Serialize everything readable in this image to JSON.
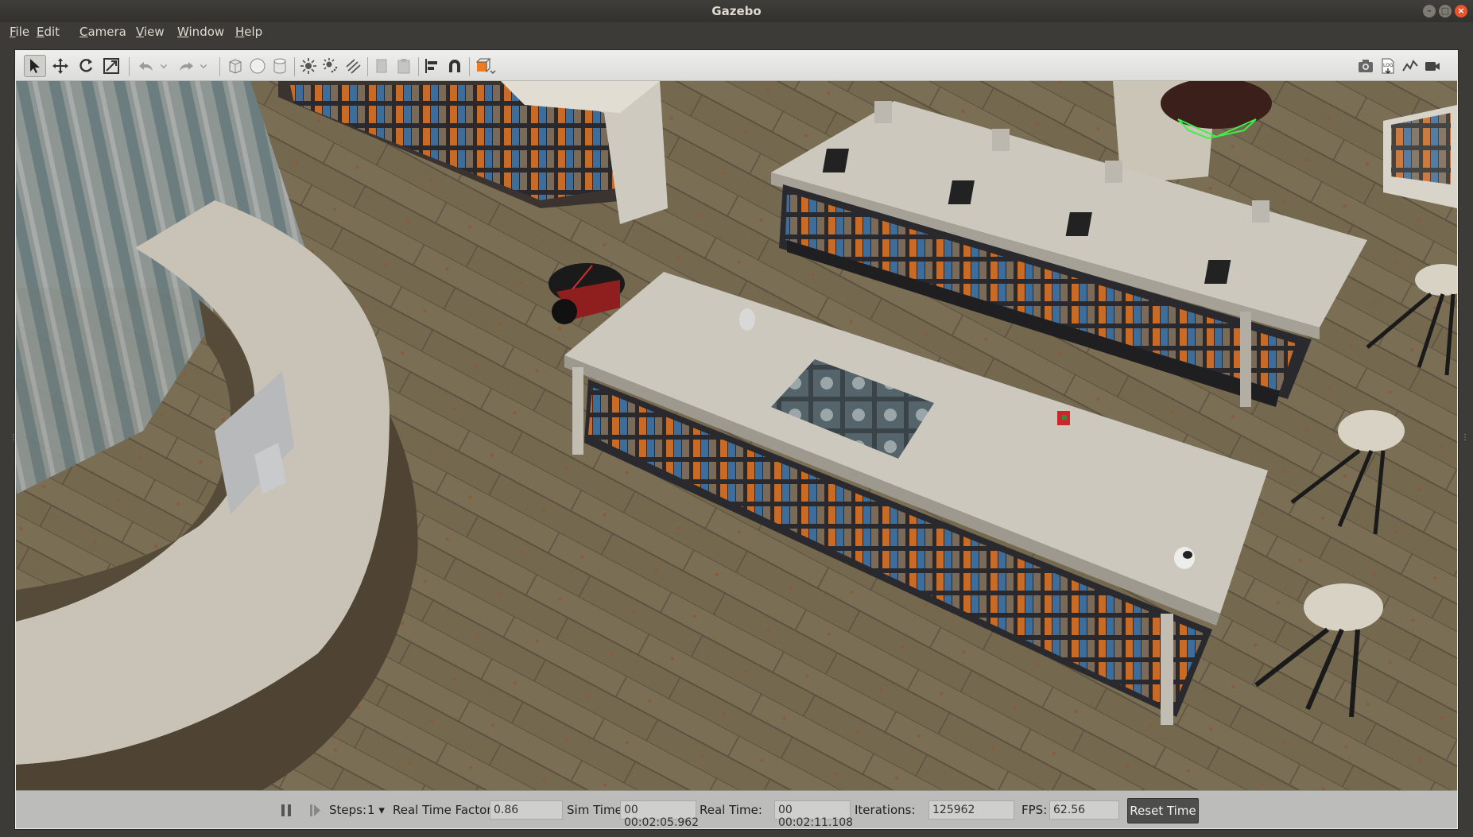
{
  "window": {
    "title": "Gazebo"
  },
  "menu": [
    {
      "label": "File",
      "mnemonic": "F",
      "rest": "ile"
    },
    {
      "label": "Edit",
      "mnemonic": "E",
      "rest": "dit"
    },
    {
      "label": "Camera",
      "mnemonic": "C",
      "rest": "amera"
    },
    {
      "label": "View",
      "mnemonic": "V",
      "rest": "iew"
    },
    {
      "label": "Window",
      "mnemonic": "W",
      "rest": "indow"
    },
    {
      "label": "Help",
      "mnemonic": "H",
      "rest": "elp"
    }
  ],
  "toolbar": {
    "left_tools": [
      "select-mode",
      "translate-mode",
      "rotate-mode",
      "scale-mode",
      "undo",
      "undo-history",
      "redo",
      "redo-history",
      "box-shape",
      "sphere-shape",
      "cylinder-shape",
      "point-light",
      "spot-light",
      "directional-light",
      "copy",
      "paste",
      "align",
      "snap",
      "view-angle"
    ],
    "right_tools": [
      "screenshot",
      "log-data",
      "plot",
      "record-video"
    ],
    "accent_color": "#f07b1e"
  },
  "status": {
    "steps_label": "Steps:",
    "steps_value": "1",
    "rtf_label": "Real Time Factor:",
    "rtf_value": "0.86",
    "sim_time_label": "Sim Time:",
    "sim_time_value": "00 00:02:05.962",
    "real_time_label": "Real Time:",
    "real_time_value": "00 00:02:11.108",
    "iterations_label": "Iterations:",
    "iterations_value": "125962",
    "fps_label": "FPS:",
    "fps_value": "62.56",
    "reset_label": "Reset Time"
  }
}
